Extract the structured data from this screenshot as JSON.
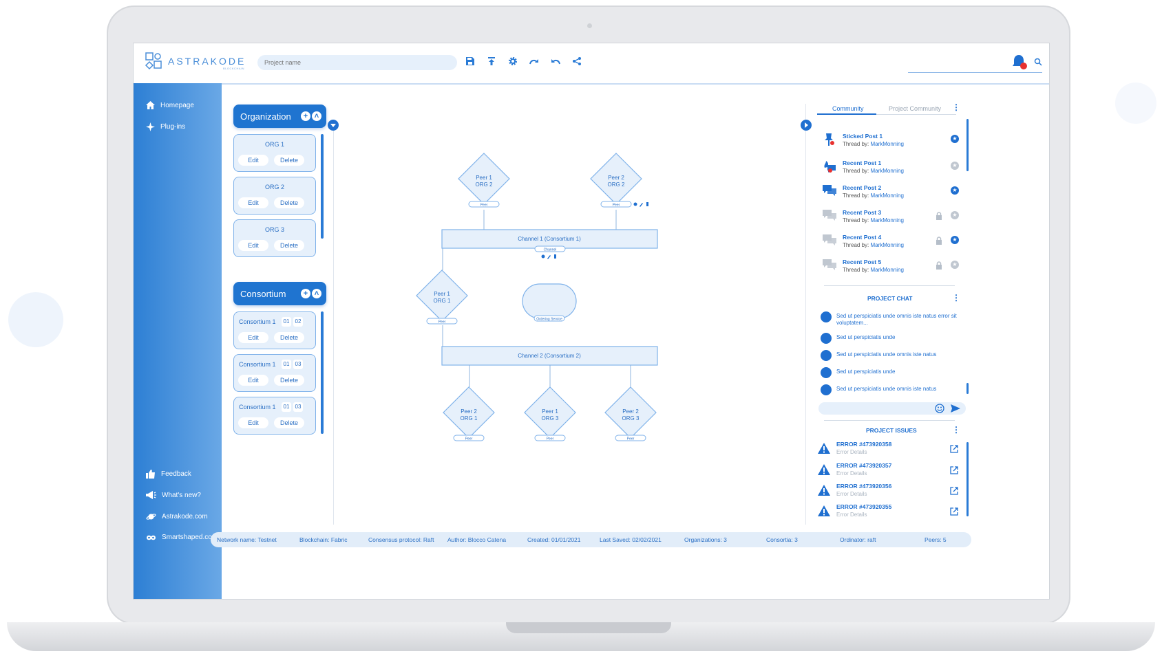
{
  "app": {
    "logo_text": "ASTRAKODE",
    "logo_sub": "BLOCKCHAIN",
    "project_placeholder": "Project name"
  },
  "toolbar": {
    "icons": [
      "save-icon",
      "upload-icon",
      "gear-icon",
      "redo-icon",
      "undo-icon",
      "share-icon"
    ]
  },
  "sidebar": {
    "top": [
      {
        "label": "Homepage",
        "icon": "home-icon"
      },
      {
        "label": "Plug-ins",
        "icon": "plugin-icon"
      }
    ],
    "bottom": [
      {
        "label": "Feedback",
        "icon": "thumbs-up-icon"
      },
      {
        "label": "What's new?",
        "icon": "megaphone-icon"
      },
      {
        "label": "Astrakode.com",
        "icon": "planet-icon"
      },
      {
        "label": "Smartshaped.com",
        "icon": "infinity-icon"
      }
    ]
  },
  "organization": {
    "title": "Organization",
    "cards": [
      {
        "name": "ORG 1",
        "edit": "Edit",
        "delete": "Delete"
      },
      {
        "name": "ORG 2",
        "edit": "Edit",
        "delete": "Delete"
      },
      {
        "name": "ORG 3",
        "edit": "Edit",
        "delete": "Delete"
      }
    ]
  },
  "consortium": {
    "title": "Consortium",
    "cards": [
      {
        "name": "Consortium 1",
        "n1": "01",
        "n2": "02",
        "edit": "Edit",
        "delete": "Delete"
      },
      {
        "name": "Consortium 1",
        "n1": "01",
        "n2": "03",
        "edit": "Edit",
        "delete": "Delete"
      },
      {
        "name": "Consortium 1",
        "n1": "01",
        "n2": "03",
        "edit": "Edit",
        "delete": "Delete"
      }
    ]
  },
  "diagram": {
    "peer_label": "Peer",
    "channel_label": "Channel",
    "ordering_label": "Ordering Service",
    "peers": [
      {
        "l1": "Peer 1",
        "l2": "ORG 2"
      },
      {
        "l1": "Peer 2",
        "l2": "ORG 2"
      },
      {
        "l1": "Peer 1",
        "l2": "ORG 1"
      },
      {
        "l1": "Peer 2",
        "l2": "ORG 1"
      },
      {
        "l1": "Peer 1",
        "l2": "ORG 3"
      },
      {
        "l1": "Peer 2",
        "l2": "ORG 3"
      }
    ],
    "channels": [
      "Channel 1 (Consortium 1)",
      "Channel 2 (Consortium 2)"
    ]
  },
  "community": {
    "tabs": [
      "Community",
      "Project Community"
    ],
    "posts": [
      {
        "title": "Sticked Post 1",
        "by": "Thread by: ",
        "author": "MarkMonning",
        "icon": "pin-icon",
        "locked": false,
        "starred": true
      },
      {
        "title": "Recent Post 1",
        "by": "Thread by: ",
        "author": "MarkMonning",
        "icon": "fire-chat-icon",
        "locked": false,
        "starred": false
      },
      {
        "title": "Recent Post 2",
        "by": "Thread by: ",
        "author": "MarkMonning",
        "icon": "chat-icon",
        "locked": false,
        "starred": true
      },
      {
        "title": "Recent Post 3",
        "by": "Thread by: ",
        "author": "MarkMonning",
        "icon": "chat-icon",
        "locked": true,
        "starred": false
      },
      {
        "title": "Recent Post 4",
        "by": "Thread by: ",
        "author": "MarkMonning",
        "icon": "chat-icon",
        "locked": true,
        "starred": true
      },
      {
        "title": "Recent Post 5",
        "by": "Thread by: ",
        "author": "MarkMonning",
        "icon": "chat-icon",
        "locked": true,
        "starred": false
      }
    ]
  },
  "chat": {
    "title": "PROJECT CHAT",
    "messages": [
      "Sed ut perspiciatis unde omnis iste natus error sit voluptatem...",
      "Sed ut perspiciatis unde",
      "Sed ut perspiciatis unde omnis iste natus",
      "Sed ut perspiciatis unde",
      "Sed ut perspiciatis unde omnis iste natus"
    ]
  },
  "issues": {
    "title": "PROJECT ISSUES",
    "items": [
      {
        "title": "ERROR #473920358",
        "detail": "Error Details"
      },
      {
        "title": "ERROR #473920357",
        "detail": "Error Details"
      },
      {
        "title": "ERROR #473920356",
        "detail": "Error Details"
      },
      {
        "title": "ERROR #473920355",
        "detail": "Error Details"
      }
    ]
  },
  "status": {
    "network": "Network name: Testnet",
    "blockchain": "Blockchain: Fabric",
    "consensus": "Consensus protocol: Raft",
    "author": "Author: Blocco Catena",
    "created": "Created: 01/01/2021",
    "saved": "Last Saved: 02/02/2021",
    "orgs": "Organizations: 3",
    "consortia": "Consortia: 3",
    "ordinator": "Ordinator: raft",
    "peers": "Peers: 5"
  },
  "colors": {
    "accent": "#1f74d0",
    "light": "#e6f0fb",
    "alert": "#e8312f"
  }
}
